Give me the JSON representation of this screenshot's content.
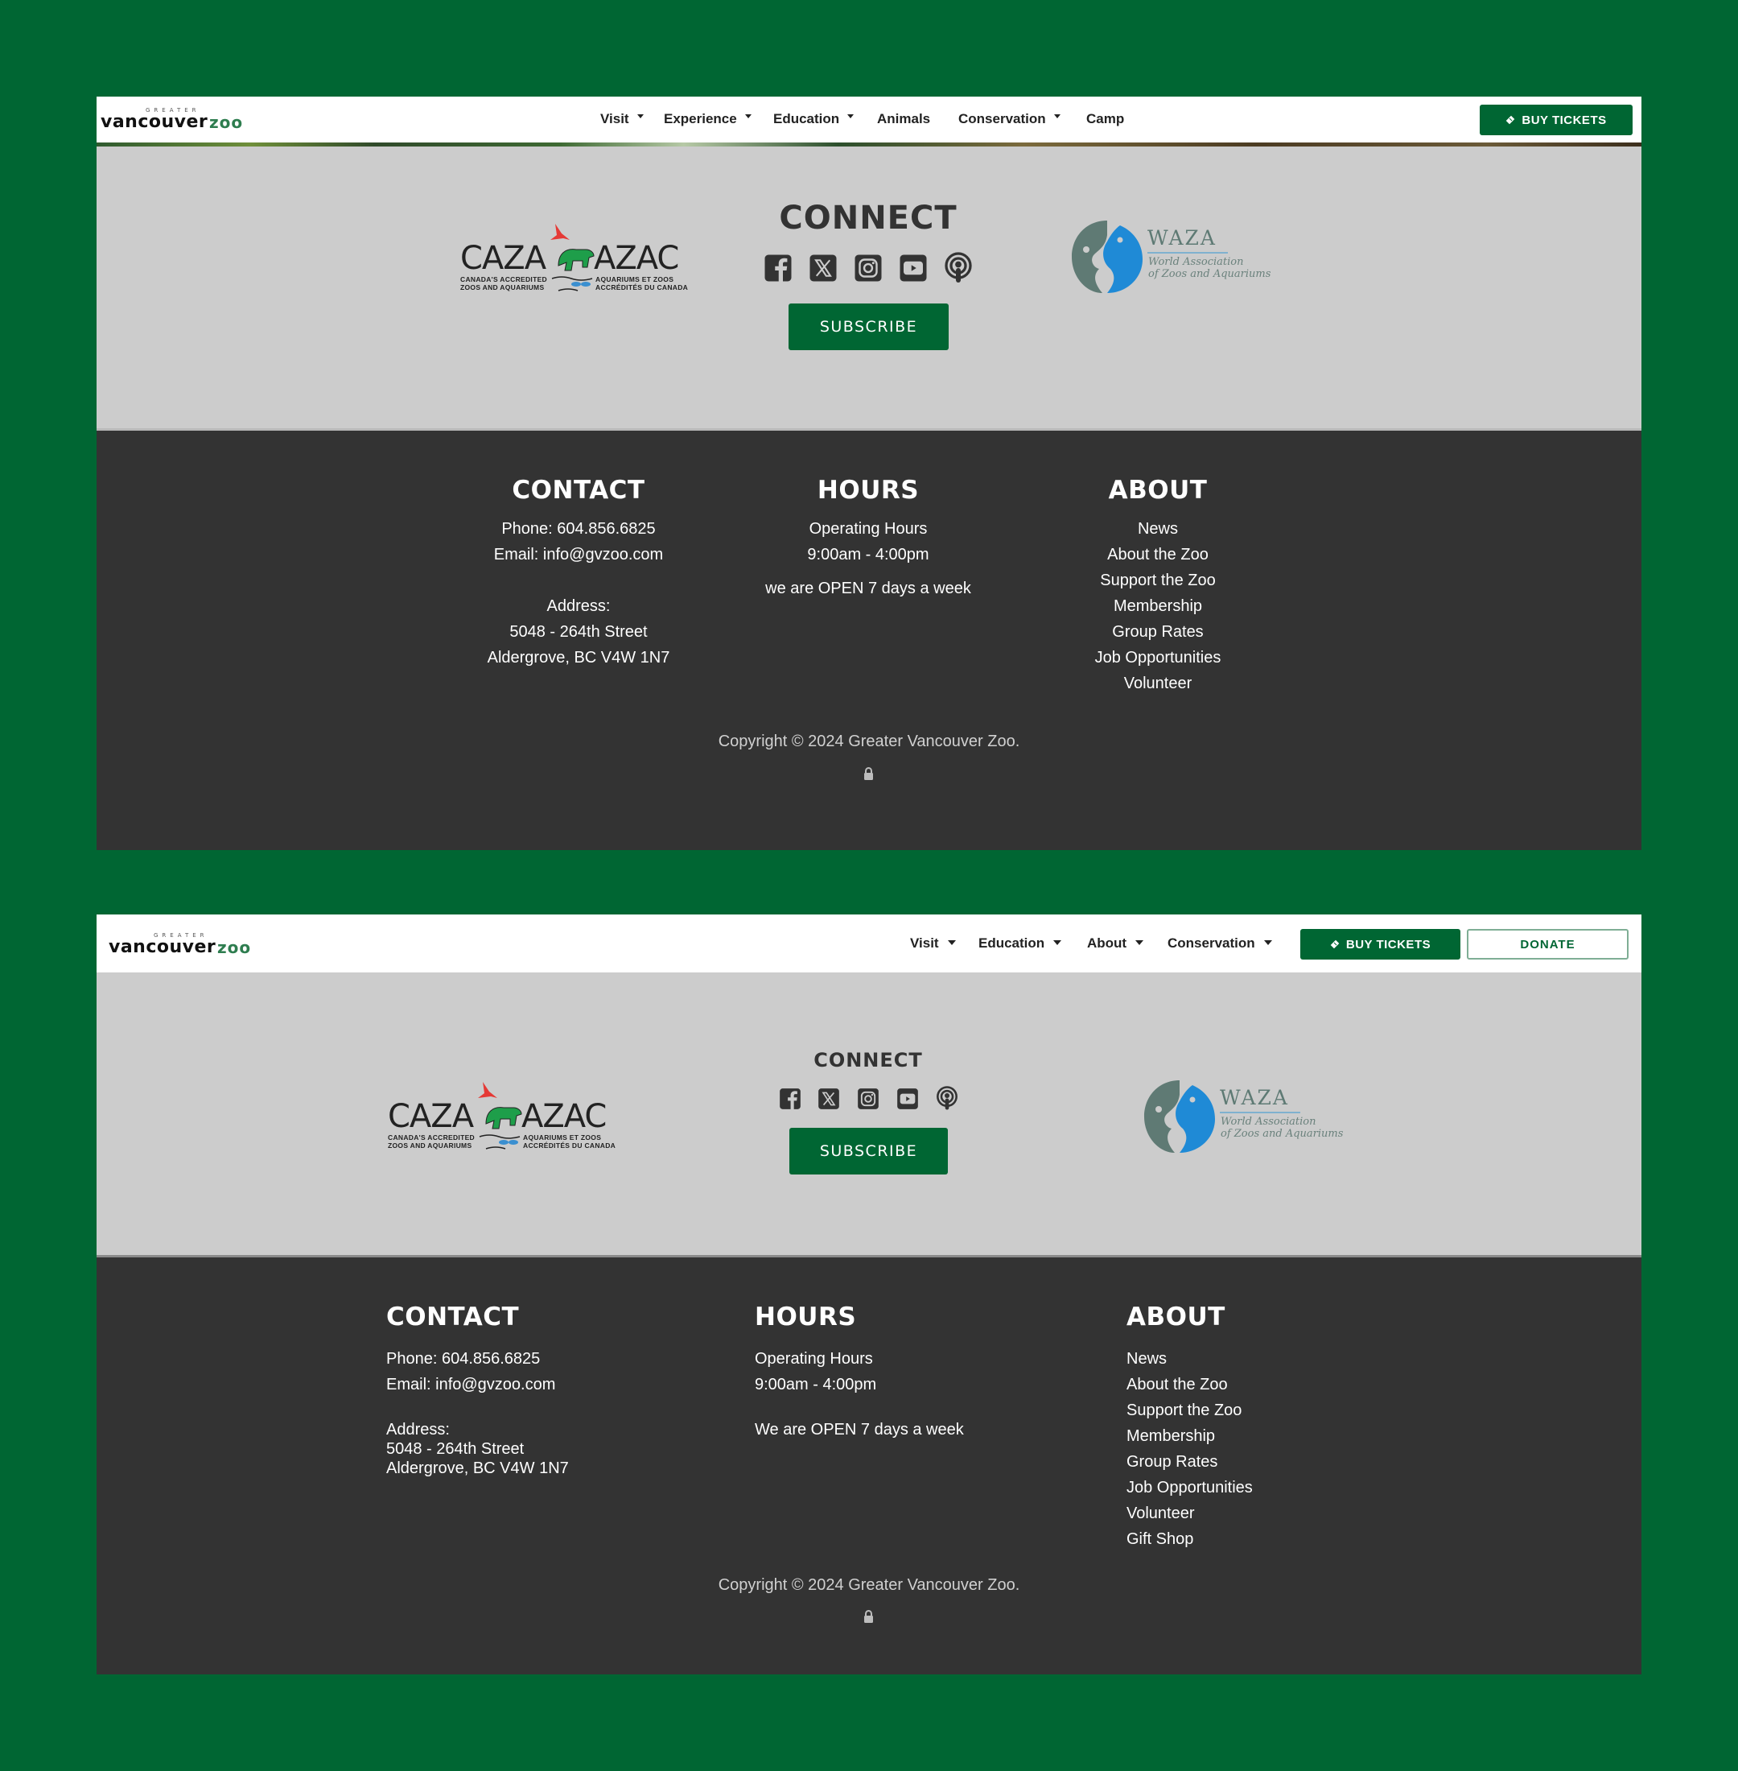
{
  "brand": {
    "logo_prefix": "GREATER",
    "logo_main": "vancouver",
    "logo_suffix": "zoo",
    "colors": {
      "primary": "#006633",
      "footer_dark": "#333333",
      "footer_gray": "#cccccc"
    }
  },
  "panel1": {
    "nav": {
      "items": [
        {
          "label": "Visit",
          "dropdown": true
        },
        {
          "label": "Experience",
          "dropdown": true
        },
        {
          "label": "Education",
          "dropdown": true
        },
        {
          "label": "Animals",
          "dropdown": false
        },
        {
          "label": "Conservation",
          "dropdown": true
        },
        {
          "label": "Camp",
          "dropdown": false
        }
      ],
      "buy_tickets": "BUY TICKETS"
    },
    "connect": {
      "title": "CONNECT",
      "social_icons": [
        "facebook-icon",
        "x-icon",
        "instagram-icon",
        "youtube-icon",
        "podcast-icon"
      ],
      "subscribe": "SUBSCRIBE"
    },
    "partners": {
      "caza": {
        "left": "CAZA",
        "right": "AZAC",
        "line1_left": "CANADA'S ACCREDITED",
        "line2_left": "ZOOS AND AQUARIUMS",
        "line1_right": "AQUARIUMS ET ZOOS",
        "line2_right": "ACCRÉDITÉS DU CANADA"
      },
      "waza": {
        "name": "WAZA",
        "line1": "World Association",
        "line2": "of Zoos and Aquariums"
      }
    },
    "footer": {
      "contact": {
        "heading": "CONTACT",
        "phone": "Phone: 604.856.6825",
        "email": "Email: info@gvzoo.com",
        "address_label": "Address:",
        "street": "5048 - 264th Street",
        "city": "Aldergrove, BC V4W 1N7"
      },
      "hours": {
        "heading": "HOURS",
        "label": "Operating Hours",
        "time": "9:00am - 4:00pm",
        "note": "we are OPEN 7 days a week"
      },
      "about": {
        "heading": "ABOUT",
        "links": [
          "News",
          "About the Zoo",
          "Support the Zoo",
          "Membership",
          "Group Rates",
          "Job Opportunities",
          "Volunteer"
        ]
      },
      "copyright": "Copyright © 2024 Greater Vancouver Zoo."
    }
  },
  "panel2": {
    "nav": {
      "items": [
        {
          "label": "Visit",
          "dropdown": true
        },
        {
          "label": "Education",
          "dropdown": true
        },
        {
          "label": "About",
          "dropdown": true
        },
        {
          "label": "Conservation",
          "dropdown": true
        }
      ],
      "buy_tickets": "BUY TICKETS",
      "donate": "DONATE"
    },
    "connect": {
      "title": "CONNECT",
      "social_icons": [
        "facebook-icon",
        "x-icon",
        "instagram-icon",
        "youtube-icon",
        "podcast-icon"
      ],
      "subscribe": "SUBSCRIBE"
    },
    "partners": {
      "caza": {
        "left": "CAZA",
        "right": "AZAC",
        "line1_left": "CANADA'S ACCREDITED",
        "line2_left": "ZOOS AND AQUARIUMS",
        "line1_right": "AQUARIUMS ET ZOOS",
        "line2_right": "ACCRÉDITÉS DU CANADA"
      },
      "waza": {
        "name": "WAZA",
        "line1": "World Association",
        "line2": "of Zoos and Aquariums"
      }
    },
    "footer": {
      "contact": {
        "heading": "CONTACT",
        "phone": "Phone: 604.856.6825",
        "email": "Email: info@gvzoo.com",
        "address_label": "Address:",
        "street": "5048 - 264th Street",
        "city": "Aldergrove, BC V4W 1N7"
      },
      "hours": {
        "heading": "HOURS",
        "label": "Operating Hours",
        "time": "9:00am - 4:00pm",
        "note": "We are OPEN 7 days a week"
      },
      "about": {
        "heading": "ABOUT",
        "links": [
          "News",
          "About the Zoo",
          "Support the Zoo",
          "Membership",
          "Group Rates",
          "Job Opportunities",
          "Volunteer",
          "Gift Shop"
        ]
      },
      "copyright": "Copyright © 2024 Greater Vancouver Zoo."
    }
  }
}
